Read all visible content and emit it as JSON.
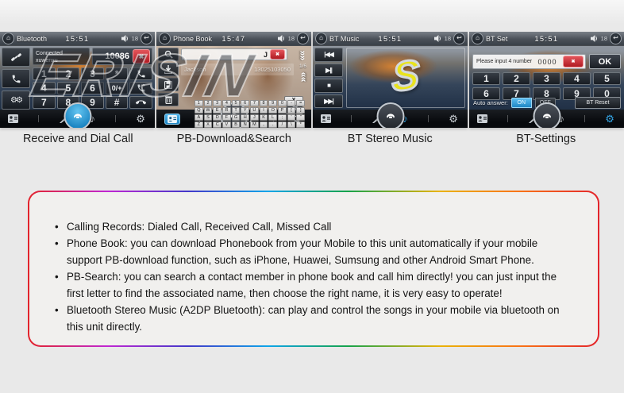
{
  "watermark": "ERISIN",
  "icons": {
    "home": "⌂",
    "return": "↩",
    "music_note": "♪",
    "gear": "⚙",
    "gears": "⚙⚙",
    "delete_x": "✖",
    "chevron": "»",
    "backspace": "⌫"
  },
  "media": {
    "prev": "|◀◀",
    "play_pause": "▶||",
    "stop": "■",
    "next": "▶▶|"
  },
  "panels": [
    {
      "title": "Bluetooth",
      "time": "15:51",
      "volume": "18",
      "caption": "Receive and Dial Call",
      "status_line1": "Connected",
      "status_line2": "xuwenxu",
      "dial_display": "10086",
      "keys": {
        "r1": [
          "1",
          "2",
          "3",
          "*"
        ],
        "r2": [
          "4",
          "5",
          "6",
          "0/+"
        ],
        "r3": [
          "7",
          "8",
          "9",
          "#"
        ]
      }
    },
    {
      "title": "Phone Book",
      "time": "15:47",
      "volume": "18",
      "caption": "PB-Download&Search",
      "search_value": "J",
      "contact_name": "Jackson",
      "contact_number": "13025103050",
      "page_indicator": "1/6",
      "kb_close": "X",
      "kb_echo": "J",
      "kb_rows": [
        "1234567890-=",
        "QWERTYUIOP[]",
        "ASDFGHJKL;'\"",
        "ZXCVBNM,./\\*"
      ]
    },
    {
      "title": "BT Music",
      "time": "15:51",
      "volume": "18",
      "caption": "BT Stereo Music",
      "logo_letter": "S"
    },
    {
      "title": "BT Set",
      "time": "15:51",
      "volume": "18",
      "caption": "BT-Settings",
      "pin_label": "Please input 4 number",
      "pin_value": "0000",
      "ok_label": "OK",
      "nums": {
        "r1": [
          "1",
          "2",
          "3",
          "4",
          "5"
        ],
        "r2": [
          "6",
          "7",
          "8",
          "9",
          "0"
        ]
      },
      "auto_answer_label": "Auto answer:",
      "toggle_on": "ON",
      "toggle_off": "OFF",
      "bt_reset_label": "BT Reset"
    }
  ],
  "info_box": {
    "bullets": [
      "Calling Records: Dialed Call, Received Call, Missed Call",
      "Phone Book: you can download Phonebook from your Mobile to this unit automatically if your mobile support PB-download function, such as iPhone, Huawei, Sumsung and other Android Smart Phone.",
      "PB-Search: you can search a contact member in phone book and call him directly! you can just input the first letter to find the associated name, then choose the right name, it is very easy to operate!",
      "Bluetooth Stereo Music (A2DP Bluetooth): can play and control the songs in your mobile via bluetooth on this unit directly."
    ]
  },
  "colors": {
    "accent_blue": "#2e9fe0",
    "delete_red": "#c4232a",
    "logo_yellow": "#e9e31d"
  }
}
